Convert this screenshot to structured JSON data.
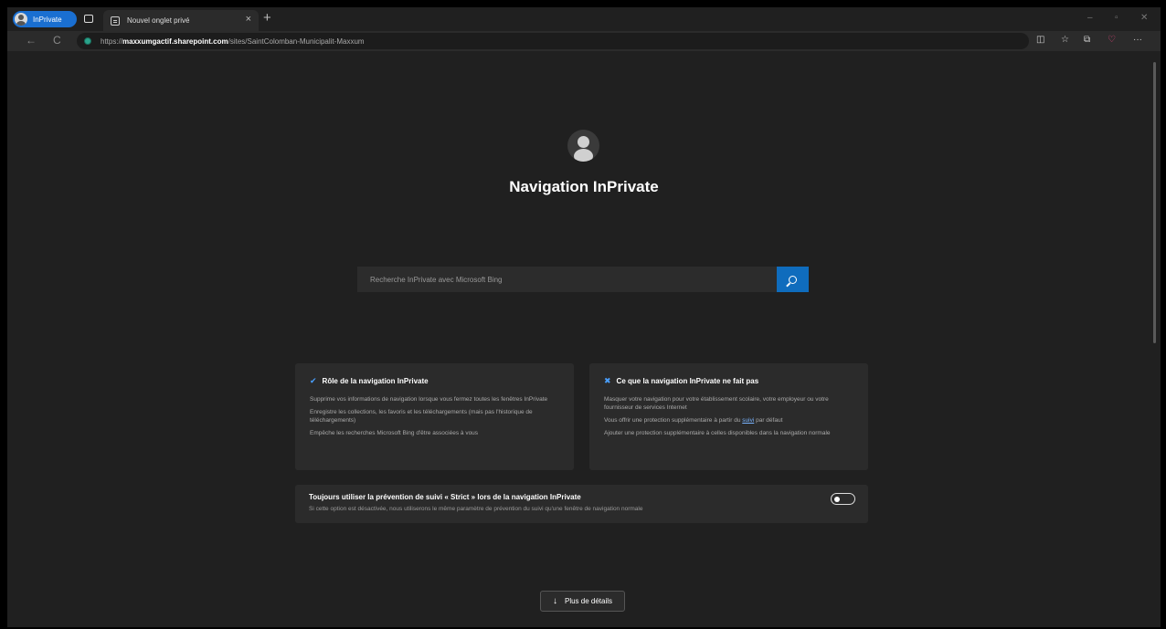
{
  "tabbar": {
    "inprivate_label": "InPrivate",
    "tab_title": "Nouvel onglet privé",
    "close_glyph": "×",
    "newtab_glyph": "+",
    "minimize_glyph": "–",
    "maximize_glyph": "▫",
    "close_window_glyph": "✕"
  },
  "addressbar": {
    "back_glyph": "←",
    "refresh_glyph": "C",
    "url_prefix": "https://",
    "url_domain": "maxxumgactif.sharepoint.com",
    "url_path": "/sites/SaintColomban-Municipalit-Maxxum",
    "toolbar_icons": [
      "split-screen-icon",
      "favorites-icon",
      "collections-icon",
      "browser-essentials-icon",
      "more-icon"
    ]
  },
  "hero": {
    "title": "Navigation InPrivate"
  },
  "search": {
    "placeholder": "Recherche InPrivate avec Microsoft Bing"
  },
  "card_does": {
    "title": "Rôle de la navigation InPrivate",
    "items": [
      "Supprime vos informations de navigation lorsque vous fermez toutes les fenêtres InPrivate",
      "Enregistre les collections, les favoris et les téléchargements (mais pas l'historique de téléchargements)",
      "Empêche les recherches Microsoft Bing d'être associées à vous"
    ]
  },
  "card_doesnt": {
    "title": "Ce que la navigation InPrivate ne fait pas",
    "items": [
      "Masquer votre navigation pour votre établissement scolaire, votre employeur ou votre fournisseur de services Internet",
      "Ajouter une protection supplémentaire à celles disponibles dans la navigation normale"
    ],
    "item2_before": "Vous offrir une protection supplémentaire à partir du ",
    "item2_link": "suivi",
    "item2_after": " par défaut"
  },
  "tracking": {
    "title": "Toujours utiliser la prévention de suivi « Strict » lors de la navigation InPrivate",
    "description": "Si cette option est désactivée, nous utiliserons le même paramètre de prévention du suivi qu'une fenêtre de navigation normale",
    "enabled": false
  },
  "more": {
    "label": "Plus de détails",
    "arrow_glyph": "↓"
  }
}
